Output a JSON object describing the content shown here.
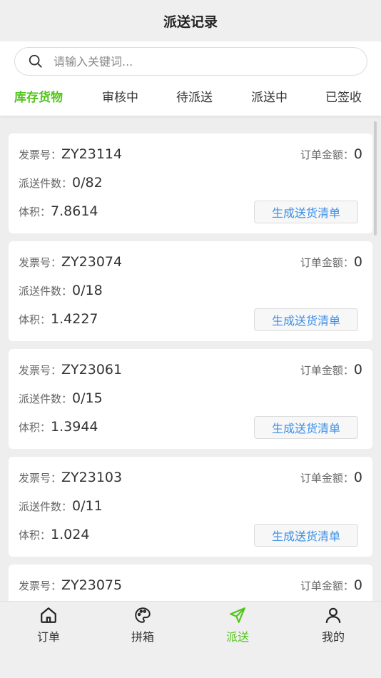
{
  "page": {
    "title": "派送记录"
  },
  "search": {
    "placeholder": "请输入关键词..."
  },
  "tabs": [
    {
      "label": "库存货物",
      "active": true
    },
    {
      "label": "审核中",
      "active": false
    },
    {
      "label": "待派送",
      "active": false
    },
    {
      "label": "派送中",
      "active": false
    },
    {
      "label": "已签收",
      "active": false
    }
  ],
  "labels": {
    "invoice": "发票号：",
    "amount": "订单金额：",
    "count": "派送件数：",
    "volume": "体积：",
    "generate": "生成送货清单"
  },
  "records": [
    {
      "invoice": "ZY23114",
      "amount": "0",
      "count": "0/82",
      "volume": "7.8614"
    },
    {
      "invoice": "ZY23074",
      "amount": "0",
      "count": "0/18",
      "volume": "1.4227"
    },
    {
      "invoice": "ZY23061",
      "amount": "0",
      "count": "0/15",
      "volume": "1.3944"
    },
    {
      "invoice": "ZY23103",
      "amount": "0",
      "count": "0/11",
      "volume": "1.024"
    },
    {
      "invoice": "ZY23075",
      "amount": "0",
      "count": "",
      "volume": ""
    }
  ],
  "nav": [
    {
      "label": "订单",
      "icon": "home-icon",
      "active": false
    },
    {
      "label": "拼箱",
      "icon": "palette-icon",
      "active": false
    },
    {
      "label": "派送",
      "icon": "send-icon",
      "active": true
    },
    {
      "label": "我的",
      "icon": "user-icon",
      "active": false
    }
  ],
  "colors": {
    "accent": "#52c41a",
    "link": "#3a8ee6"
  }
}
